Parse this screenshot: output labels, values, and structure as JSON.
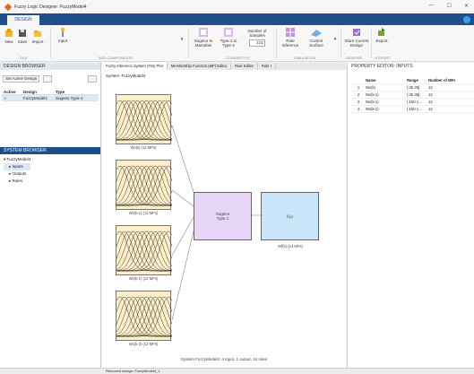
{
  "window": {
    "title": "Fuzzy Logic Designer: FuzzyModel4",
    "controls": [
      "—",
      "☐",
      "✕"
    ]
  },
  "ribbon": {
    "tab": "DESIGN",
    "file": {
      "new": "New",
      "save": "Save",
      "import": "Import",
      "section": "FILE"
    },
    "add_components": {
      "input": "Input",
      "section": "ADD COMPONENTS"
    },
    "convert": {
      "sugeno_to_mamdani": "Sugeno to Mamdani",
      "type1_to_type2": "Type-1 to Type-2",
      "num_samples_label": "Number of Samples",
      "num_samples_value": "101",
      "section": "CONVERT FIS"
    },
    "simulation": {
      "rule_inference": "Rule Inference",
      "control_surface": "Control Surface",
      "section": "SIMULATION"
    },
    "designs": {
      "store": "Store Current Design",
      "section": "DESIGNS"
    },
    "export": {
      "label": "Export",
      "section": "EXPORT"
    }
  },
  "design_browser": {
    "header": "DESIGN BROWSER",
    "set_active": "Set Active Design",
    "columns": [
      "Active",
      "Design",
      "Type"
    ],
    "rows": [
      {
        "active": "✓",
        "design": "FuzzyModel4",
        "type": "Sugeno Type-1"
      }
    ]
  },
  "system_browser": {
    "header": "SYSTEM BROWSER",
    "root": "FuzzyModel4",
    "items": [
      "Inputs",
      "Outputs",
      "Rules"
    ]
  },
  "center": {
    "tabs": [
      "Fuzzy Inference System (FIS) Plot",
      "Membership Function (MF) Editor",
      "Rule Editor",
      "Rule I"
    ],
    "system_label": "System: FuzzyModel4",
    "inputs": [
      "Wx(k) (12 MFs)",
      "Wx(k-1) (12 MFs)",
      "Wx(k-1) (12 MFs)",
      "Wx(k-2) (12 MFs)"
    ],
    "fis_label": "Sugeno\nType 1",
    "output_name": "f(u)",
    "output_caption": "Wf(k) (14 MFs)",
    "summary": "System FuzzyModel4: 4 input, 1 output, 16 rules"
  },
  "property_editor": {
    "header": "PROPERTY EDITOR: INPUTS",
    "columns": [
      "",
      "Name",
      "Range",
      "Number of MFs"
    ],
    "rows": [
      [
        "1",
        "Wx(k)",
        "[-35 35]",
        "12"
      ],
      [
        "2",
        "Wx(k-1)",
        "[-35 35]",
        "12"
      ],
      [
        "3",
        "Wx(k-1)",
        "[-150 1...",
        "12"
      ],
      [
        "4",
        "Wx(k-2)",
        "[-150 1...",
        "12"
      ]
    ]
  },
  "status": {
    "left": "",
    "message": "Removed design: FuzzyModel4_1"
  },
  "colors": {
    "accent": "#1f4f8b",
    "mf_fill": "#fdf0c8",
    "fis_fill": "#e6d5f7",
    "output_fill": "#c9e6fb"
  }
}
